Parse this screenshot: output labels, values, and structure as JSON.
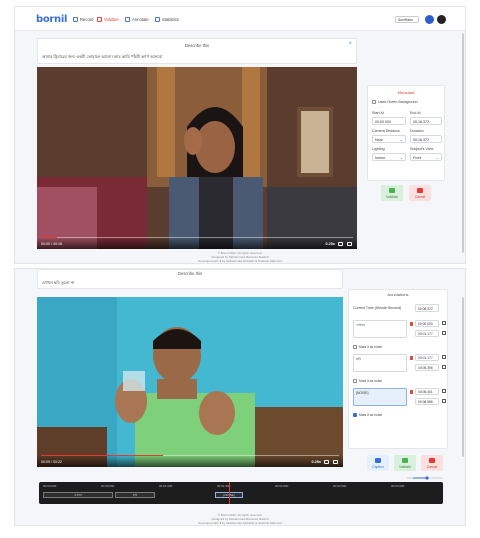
{
  "nav": {
    "logo": "bornil",
    "items": [
      {
        "label": "Record",
        "icon": "video-icon"
      },
      {
        "label": "Validate",
        "icon": "check-icon"
      },
      {
        "label": "Annotate",
        "icon": "annotate-icon"
      },
      {
        "label": "Statistics",
        "icon": "chart-icon"
      }
    ],
    "active_item": "Validate",
    "dataset_select": "Sun/Ratio"
  },
  "screen1": {
    "describe_title": "Describe this",
    "describe_text": "আমার ট্রিমারের জন্য একটা তোয়ালে আনো। আর আমি পাঁচটা ক্যাপ আনবো",
    "video_time": "00:00 / 00:16",
    "video_speed": "0.25x",
    "video_progress": 0.05,
    "metadata": {
      "title": "Metadata",
      "used_green_bg": "Used Green Background",
      "used_green_bg_checked": false,
      "start_label": "Start At",
      "start_value": "00:00.000",
      "end_label": "End At",
      "end_value": "00:16.372",
      "camera_label": "Camera Distance",
      "camera_value": "Near",
      "duration_label": "Duration",
      "duration_value": "00:16.372",
      "lighting_label": "Lighting",
      "lighting_value": "Indoor",
      "subject_label": "Subject's View",
      "subject_value": "Front",
      "validate_label": "Validate",
      "cancel_label": "Cancel"
    },
    "footer": {
      "line1": "© Bornil 2022. All rights reserved.",
      "line2": "Designed by Mohammad Mamunur Rashid",
      "line3": "Developed with ♥ by Mohammad Abdullah & Shahriar Mahmud"
    }
  },
  "screen2": {
    "describe_title": "Describe this",
    "describe_text": "এখানে ছবি তুলো না",
    "video_time": "00:09 / 00:22",
    "video_speed": "0.25x",
    "video_progress": 0.41,
    "annotations": {
      "title": "Annotations",
      "current_time_label": "Current Time (Minute:Second)",
      "current_time_value": "00:06.372",
      "rows": [
        {
          "text": "এখানে",
          "start": "00:00.000",
          "end": "00:01.177",
          "mark_label": "Mark it as noise",
          "marked": false
        },
        {
          "text": "ছবি",
          "start": "00:01.177",
          "end": "00:05.396",
          "mark_label": "Mark it as noise",
          "marked": false
        },
        {
          "text": "[NOISE]",
          "start": "00:06.401",
          "end": "00:06.986",
          "mark_label": "Mark it as noise",
          "marked": true
        }
      ],
      "caption_label": "Caption",
      "validate_label": "Validate",
      "cancel_label": "Cancel"
    },
    "timeline": {
      "ticks": [
        "00:00.000",
        "00:00.500",
        "00:01.000",
        "00:01.500",
        "00:02.000",
        "00:02.500",
        "00:03.000"
      ],
      "segments": [
        "এখানে",
        "ছবি",
        "[NOISE]"
      ]
    },
    "footer": {
      "line1": "© Bornil 2022. All rights reserved.",
      "line2": "Designed by Mohammad Mamunur Rashid",
      "line3": "Developed with ♥ by Mohammad Abdullah & Shahriar Mahmud"
    }
  },
  "colors": {
    "brand": "#3b6fd8",
    "accent": "#e04a3a",
    "validate_green": "#4caf50",
    "cancel_red": "#e53935"
  }
}
